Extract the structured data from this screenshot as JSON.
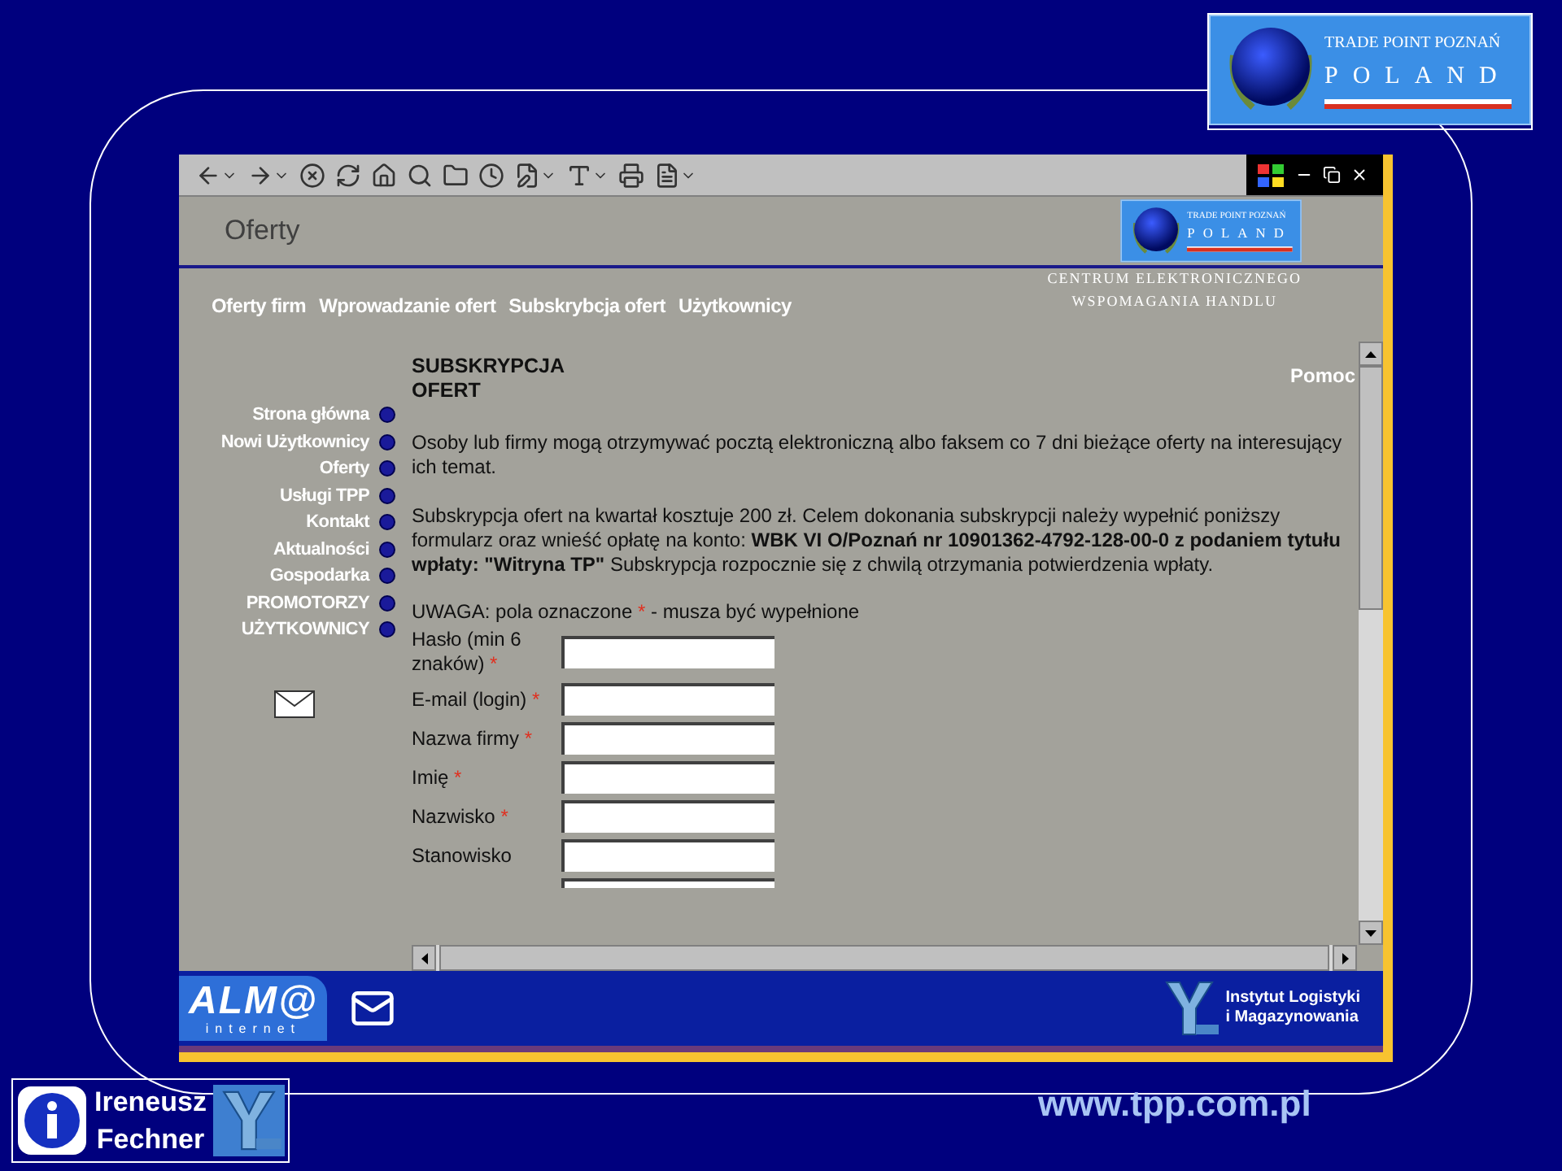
{
  "slide_logo": {
    "line1": "TRADE POINT POZNAŃ",
    "line2": "POLAND"
  },
  "page": {
    "title": "Oferty",
    "logo": {
      "line1": "TRADE POINT POZNAŃ",
      "line2": "POLAND"
    },
    "centrum": [
      "CENTRUM ELEKTRONICZNEGO",
      "WSPOMAGANIA HANDLU"
    ],
    "nav": [
      "Oferty firm",
      "Wprowadzanie ofert",
      "Subskrybcja ofert",
      "Użytkownicy"
    ],
    "sidebar": [
      "Strona główna",
      "Nowi Użytkownicy",
      "Oferty",
      "Usługi TPP",
      "Kontakt",
      "Aktualności",
      "Gospodarka",
      "PROMOTORZY",
      "UŻYTKOWNICY"
    ],
    "heading": [
      "SUBSKRYPCJA",
      "OFERT"
    ],
    "help": "Pomoc",
    "paragraphs": [
      "Osoby lub firmy mogą otrzymywać pocztą elektroniczną albo faksem co 7 dni bieżące oferty na interesujący ich temat.",
      "Subskrypcja ofert na kwartał kosztuje 200 zł. Celem dokonania subskrypcji należy wypełnić poniższy formularz oraz wnieść opłatę na konto: **WBK VI O/Poznań nr 10901362-4792-128-00-0 z podaniem tytułu wpłaty: \"Witryna TP\"** Subskrypcja rozpocznie się z chwilą otrzymania potwierdzenia wpłaty."
    ],
    "notice": {
      "before": "UWAGA: pola oznaczone",
      "mark": "*",
      "after": "- musza być wypełnione"
    },
    "fields": [
      {
        "label": "Hasło (min 6 znaków)",
        "mark": "*"
      },
      {
        "label": "E-mail (login)",
        "mark": "*"
      },
      {
        "label": "Nazwa firmy",
        "mark": "*"
      },
      {
        "label": "Imię",
        "mark": "*"
      },
      {
        "label": "Nazwisko",
        "mark": "*"
      },
      {
        "label": "Stanowisko"
      }
    ],
    "footer": {
      "alma": "ALM@",
      "alma_sub": "internet",
      "institute": [
        "Instytut Logistyki",
        "i Magazynowania"
      ]
    }
  },
  "author": [
    "Ireneusz",
    "Fechner"
  ],
  "url": "www.tpp.com.pl"
}
